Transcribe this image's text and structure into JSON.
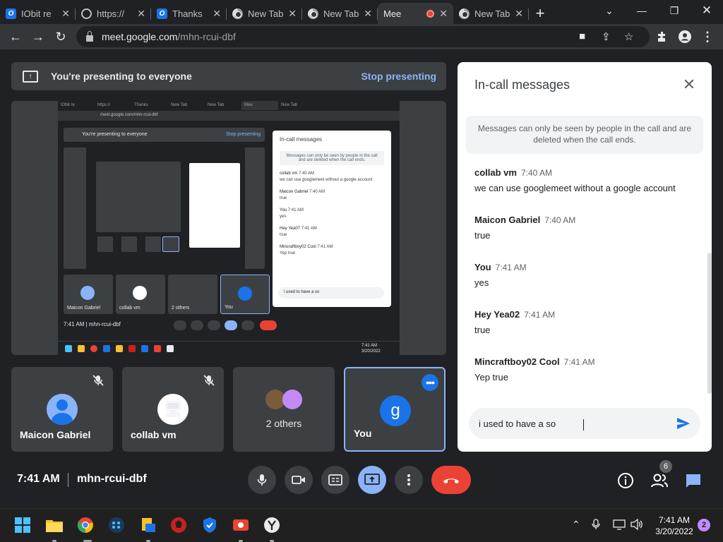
{
  "browser": {
    "tabs": [
      {
        "title": "IObit re",
        "icon": "iobit-icon"
      },
      {
        "title": "https://",
        "icon": "globe-icon"
      },
      {
        "title": "Thanks",
        "icon": "iobit-icon"
      },
      {
        "title": "New Tab",
        "icon": "chrome-icon"
      },
      {
        "title": "New Tab",
        "icon": "chrome-icon"
      },
      {
        "title": "Mee",
        "icon": "meet-icon",
        "active": true,
        "recording": true
      },
      {
        "title": "New Tab",
        "icon": "chrome-icon"
      }
    ],
    "url_host": "meet.google.com",
    "url_path": "/mhn-rcui-dbf"
  },
  "meet": {
    "presenting_text": "You're presenting to everyone",
    "stop_presenting_label": "Stop presenting",
    "tiles": [
      {
        "name": "Maicon Gabriel",
        "muted": true
      },
      {
        "name": "collab vm",
        "muted": true
      },
      {
        "name": "2 others"
      },
      {
        "name": "You",
        "initial": "g"
      }
    ],
    "time": "7:41 AM",
    "meeting_code": "mhn-rcui-dbf",
    "people_count": "6"
  },
  "mini": {
    "tabs": [
      "IObit re",
      "https://",
      "Thanks",
      "New Tab",
      "New Tab",
      "Mee",
      "New Tab"
    ],
    "url": "meet.google.com/mhn-rcui-dbf",
    "presenting": "You're presenting to everyone",
    "stop": "Stop presenting",
    "panel_title": "In-call messages",
    "notice": "Messages can only be seen by people in the call and are deleted when the call ends.",
    "messages": [
      {
        "sender": "collab vm",
        "time": "7:40 AM",
        "text": "we can use googlemeet without a google account"
      },
      {
        "sender": "Maicon Gabriel",
        "time": "7:40 AM",
        "text": "true"
      },
      {
        "sender": "You",
        "time": "7:41 AM",
        "text": "yes"
      },
      {
        "sender": "Hey Yea07",
        "time": "7:41 AM",
        "text": "true"
      },
      {
        "sender": "Mincraftboy02 Cool",
        "time": "7:41 AM",
        "text": "Yep true"
      }
    ],
    "input": "i used to have a so",
    "tiles": [
      "Maicon Gabriel",
      "collab vm",
      "2 others",
      "You"
    ],
    "time": "7:41 AM",
    "code": "mhn-rcui-dbf",
    "clock_time": "7:41 AM",
    "clock_date": "3/20/2022"
  },
  "chat": {
    "title": "In-call messages",
    "notice": "Messages can only be seen by people in the call and are deleted when the call ends.",
    "messages": [
      {
        "sender": "collab vm",
        "time": "7:40 AM",
        "text": "we can use googlemeet without a google account"
      },
      {
        "sender": "Maicon Gabriel",
        "time": "7:40 AM",
        "text": "true"
      },
      {
        "sender": "You",
        "time": "7:41 AM",
        "text": "yes"
      },
      {
        "sender": "Hey Yea02",
        "time": "7:41 AM",
        "text": "true"
      },
      {
        "sender": "Mincraftboy02 Cool",
        "time": "7:41 AM",
        "text": "Yep true"
      }
    ],
    "input_value": "i used to have a so"
  },
  "taskbar": {
    "time": "7:41 AM",
    "date": "3/20/2022",
    "notifications": "2"
  },
  "colors": {
    "accent": "#8ab4f8",
    "hangup": "#ea4335",
    "meet_blue": "#1a73e8"
  }
}
